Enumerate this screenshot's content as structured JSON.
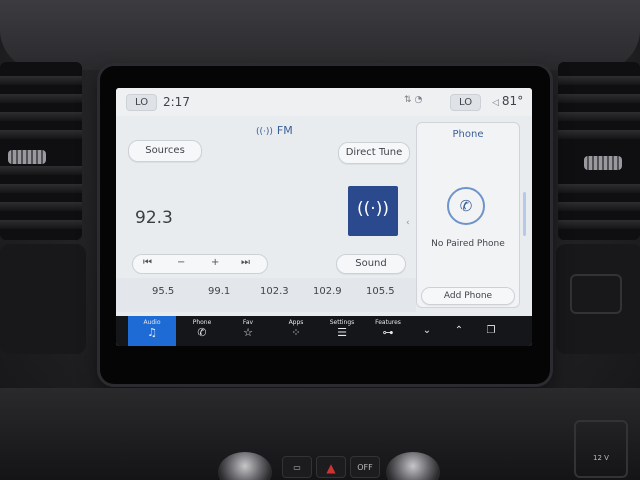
{
  "status_bar": {
    "left_lo": "LO",
    "time": "2:17",
    "right_lo": "LO",
    "temperature": "81°"
  },
  "radio": {
    "band": "FM",
    "sources_label": "Sources",
    "direct_tune_label": "Direct Tune",
    "frequency": "92.3",
    "sound_label": "Sound",
    "seek_back_icon": "⏮",
    "minus": "−",
    "plus": "+",
    "seek_forward_icon": "⏭",
    "presets": [
      "95.5",
      "99.1",
      "102.3",
      "102.9",
      "105.5"
    ]
  },
  "phone_panel": {
    "title": "Phone",
    "status": "No Paired Phone",
    "add_phone_label": "Add Phone"
  },
  "nav": [
    {
      "label": "Audio",
      "icon": "music-note-icon",
      "active": true
    },
    {
      "label": "Phone",
      "icon": "phone-icon",
      "active": false
    },
    {
      "label": "Fav",
      "icon": "star-icon",
      "active": false
    },
    {
      "label": "Apps",
      "icon": "apps-grid-icon",
      "active": false
    },
    {
      "label": "Settings",
      "icon": "settings-sliders-icon",
      "active": false
    },
    {
      "label": "Features",
      "icon": "car-features-icon",
      "active": false
    }
  ],
  "colors": {
    "accent": "#1f6bd6",
    "station_art": "#2b4a8e",
    "screen_bg": "#e9ecef",
    "navbar": "#14161a"
  }
}
